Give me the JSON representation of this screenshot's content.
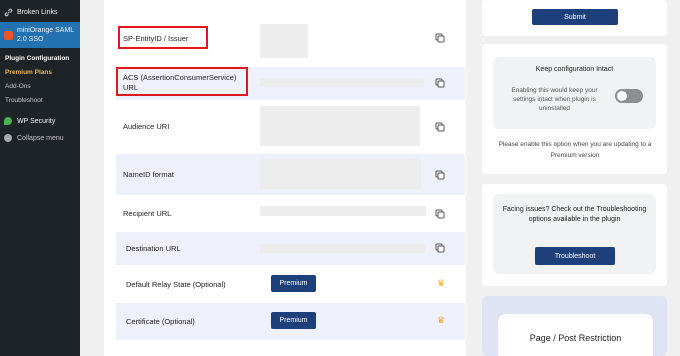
{
  "sidebar": {
    "broken_links": "Broken Links",
    "plugin_name_line1": "miniOrange SAML",
    "plugin_name_line2": "2.0 SSO",
    "sub_items": [
      "Plugin Configuration",
      "Premium Plans",
      "Add-Ons",
      "Troubleshoot"
    ],
    "wp_security": "WP Security",
    "collapse": "Collapse menu"
  },
  "rows": [
    {
      "label": "SP-EntityID / Issuer"
    },
    {
      "label_line1": "ACS (AssertionConsumerService)",
      "label_line2": "URL"
    },
    {
      "label": "Audience URI"
    },
    {
      "label": "NameID format"
    },
    {
      "label": "Recipient URL"
    },
    {
      "label": "Destination URL"
    },
    {
      "label": "Default Relay State (Optional)",
      "button": "Premium"
    },
    {
      "label": "Certificate (Optional)",
      "button": "Premium"
    }
  ],
  "right": {
    "submit": "Submit",
    "keep_title": "Keep configuration Intact",
    "keep_text": "Enabling this would keep your settings intact when plugin is uninstalled",
    "keep_enabled": false,
    "note": "Please enable this option when you are updating to a Premium version",
    "issue_text": "Facing issues? Check out the Troubleshooting options available in the plugin",
    "troubleshoot": "Troubleshoot",
    "page_post": "Page / Post Restriction"
  },
  "colors": {
    "accent": "#1d3f7a",
    "highlight": "#e0181e",
    "sidebar": "#1d2327",
    "active": "#2271b1"
  }
}
